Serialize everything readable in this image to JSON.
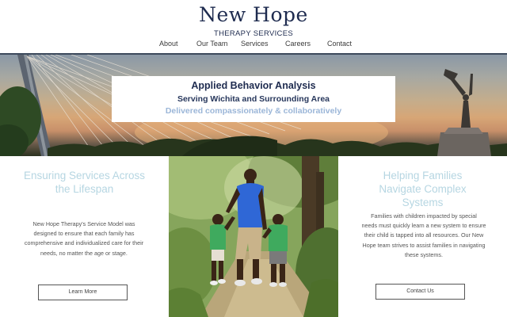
{
  "header": {
    "brand_title": "New Hope",
    "brand_subtitle": "THERAPY SERVICES",
    "nav": [
      {
        "label": "About"
      },
      {
        "label": "Our Team"
      },
      {
        "label": "Services"
      },
      {
        "label": "Careers"
      },
      {
        "label": "Contact"
      }
    ]
  },
  "hero": {
    "title": "Applied Behavior Analysis",
    "subtitle": "Serving Wichita and Surrounding Area",
    "tagline": "Delivered compassionately & collaboratively"
  },
  "left_column": {
    "heading_line1": "Ensuring Services Across",
    "heading_line2": "the Lifespan",
    "body_lines": [
      "New Hope Therapy's Service Model was",
      "designed to ensure that each family has",
      "comprehensive and individualized care for their",
      "needs, no matter the age or stage."
    ],
    "button_label": "Learn More"
  },
  "right_column": {
    "heading_line1": "Helping Families",
    "heading_line2": "Navigate Complex",
    "heading_line3": "Systems",
    "body_lines": [
      "Families with children impacted by special",
      "needs must quickly learn a new system to ensure",
      "their child is tapped into all resources. Our New",
      "Hope team strives to assist families in navigating",
      "these systems."
    ],
    "button_label": "Contact Us"
  },
  "colors": {
    "brand_navy": "#1e2b4f",
    "heading_light_blue": "#b6d6e2",
    "tagline_blue": "#9bb6d8"
  }
}
